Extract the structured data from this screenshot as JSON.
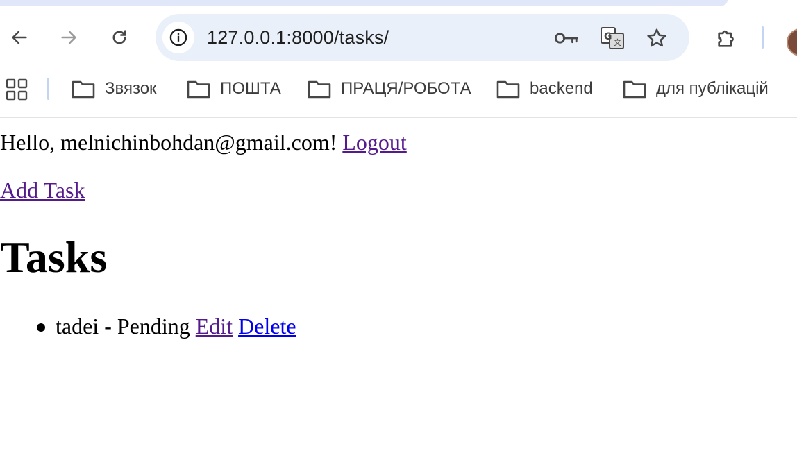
{
  "browser": {
    "url": "127.0.0.1:8000/tasks/",
    "icons": {
      "back": "arrow-left-icon",
      "forward": "arrow-right-icon",
      "reload": "reload-icon",
      "site_info": "info-icon",
      "passwords": "key-icon",
      "translate": "translate-icon",
      "bookmark": "star-icon",
      "extensions": "puzzle-icon"
    },
    "accent_color": "#eaf0f9"
  },
  "bookmarks": [
    {
      "label": "Звязок",
      "icon": "folder-icon"
    },
    {
      "label": "ПОШТА",
      "icon": "folder-icon"
    },
    {
      "label": "ПРАЦЯ/РОБОТА",
      "icon": "folder-icon"
    },
    {
      "label": "backend",
      "icon": "folder-icon"
    },
    {
      "label": "для публікацій",
      "icon": "folder-icon"
    }
  ],
  "page": {
    "greeting_prefix": "Hello, melnichinbohdan@gmail.com!",
    "logout_label": "Logout",
    "add_task_label": "Add Task",
    "title": "Tasks",
    "tasks": [
      {
        "name": "tadei",
        "separator": " - ",
        "status": "Pending",
        "edit_label": "Edit",
        "delete_label": "Delete"
      }
    ],
    "link_colors": {
      "visited": "#551a8b",
      "unvisited": "#0000ee"
    }
  }
}
